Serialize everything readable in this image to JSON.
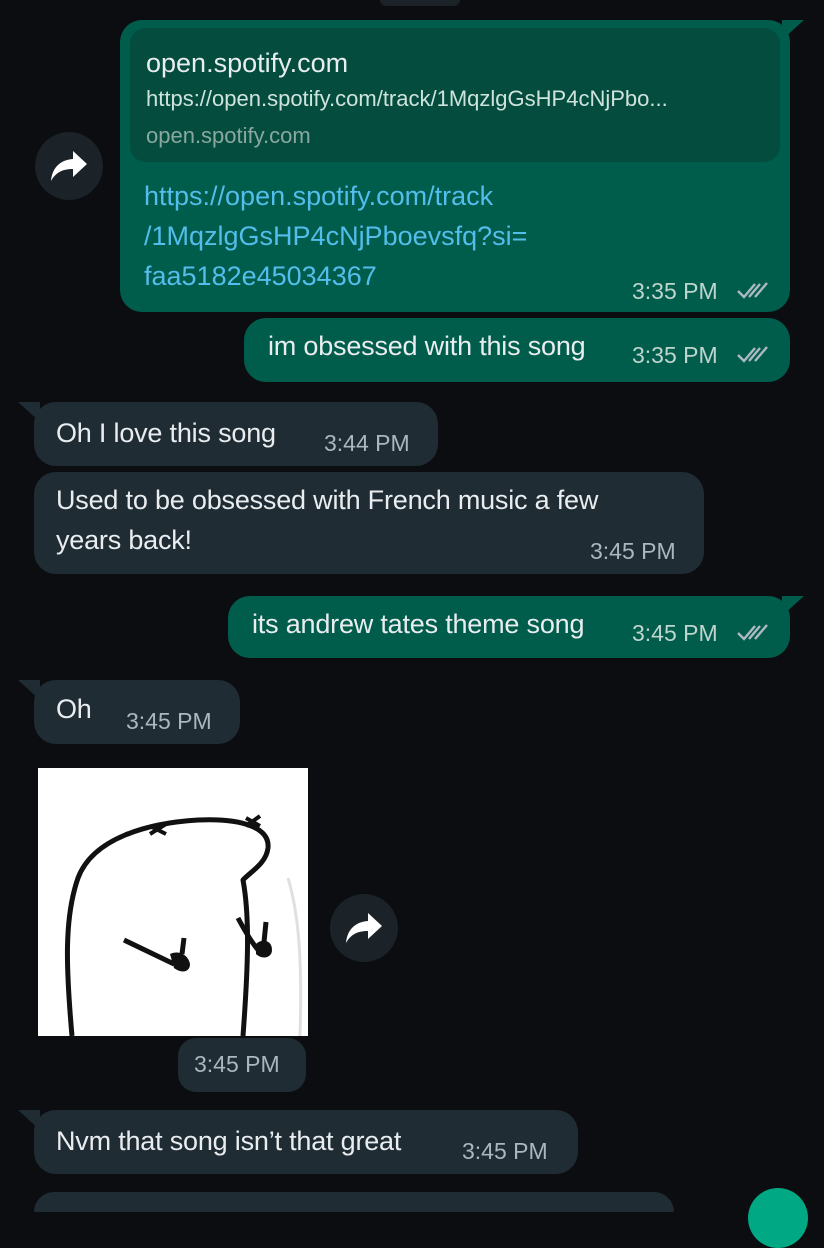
{
  "messages": {
    "m1": {
      "preview_title": "open.spotify.com",
      "preview_url": "https://open.spotify.com/track/1MqzlgGsHP4cNjPbo...",
      "preview_domain": "open.spotify.com",
      "link_line1": "https://open.spotify.com/track",
      "link_line2": "/1MqzlgGsHP4cNjPboevsfq?si=",
      "link_line3": "faa5182e45034367",
      "time": "3:35 PM"
    },
    "m2": {
      "text": "im obsessed with this song",
      "time": "3:35 PM"
    },
    "m3": {
      "text": "Oh I love this song",
      "time": "3:44 PM"
    },
    "m4": {
      "line1": "Used to be obsessed with French music a few",
      "line2": "years back!",
      "time": "3:45 PM"
    },
    "m5": {
      "text": "its andrew tates theme song",
      "time": "3:45 PM"
    },
    "m6": {
      "text": "Oh",
      "time": "3:45 PM"
    },
    "m7": {
      "time": "3:45 PM"
    },
    "m8": {
      "text": "Nvm that song isn’t that great",
      "time": "3:45 PM"
    }
  },
  "icons": {
    "forward": "forward-arrow-icon",
    "read_receipt": "double-check-icon",
    "sticker": "middle-finger-blob-sticker"
  },
  "colors": {
    "outgoing": "#005c4b",
    "incoming": "#1f2c34",
    "link": "#53bdeb",
    "background": "#0b0d10"
  }
}
